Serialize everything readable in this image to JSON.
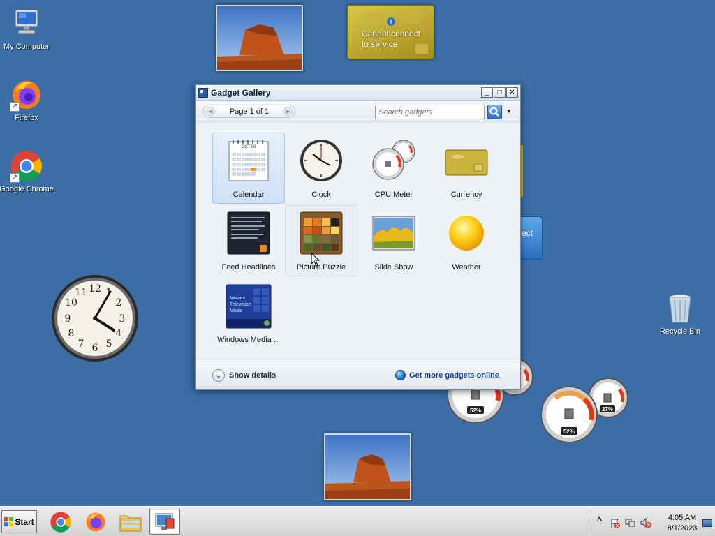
{
  "desktop": {
    "icons": [
      {
        "label": "My Computer",
        "icon": "my-computer-icon"
      },
      {
        "label": "Firefox",
        "icon": "firefox-icon"
      },
      {
        "label": "Google Chrome",
        "icon": "chrome-icon"
      },
      {
        "label": "Recycle Bin",
        "icon": "recycle-bin-icon"
      }
    ],
    "currency_gadget": {
      "message_line1": "Cannot connect",
      "message_line2": "to service",
      "info_glyph": "i"
    },
    "cpu_meter_1": {
      "cpu": "52%"
    },
    "cpu_meter_2": {
      "cpu": "52%",
      "memory": "27%"
    },
    "peek_blue_text": "ect",
    "clock_gadget": {
      "hour": 4,
      "minute": 5
    }
  },
  "gallery": {
    "title": "Gadget Gallery",
    "window_buttons": {
      "minimize": "_",
      "maximize": "□",
      "close": "✕"
    },
    "pager": {
      "label": "Page 1 of 1",
      "prev": "◀",
      "next": "▶"
    },
    "search": {
      "placeholder": "Search gadgets",
      "dropdown": "▼"
    },
    "gadgets": [
      {
        "label": "Calendar",
        "icon": "calendar-icon",
        "state": "selected"
      },
      {
        "label": "Clock",
        "icon": "clock-icon"
      },
      {
        "label": "CPU Meter",
        "icon": "cpu-meter-icon"
      },
      {
        "label": "Currency",
        "icon": "currency-icon"
      },
      {
        "label": "Feed Headlines",
        "icon": "feed-headlines-icon"
      },
      {
        "label": "Picture Puzzle",
        "icon": "picture-puzzle-icon",
        "state": "hovered"
      },
      {
        "label": "Slide Show",
        "icon": "slide-show-icon"
      },
      {
        "label": "Weather",
        "icon": "weather-icon"
      },
      {
        "label": "Windows Media ...",
        "icon": "windows-media-center-icon"
      }
    ],
    "calendar_month": "OCT 06",
    "wmc_items": [
      "Movies",
      "Television",
      "Music"
    ],
    "show_details": "Show details",
    "show_details_glyph": "⌄",
    "more_gadgets": "Get more gadgets online"
  },
  "taskbar": {
    "start_label": "Start",
    "items": [
      {
        "name": "chrome",
        "icon": "chrome-icon"
      },
      {
        "name": "firefox",
        "icon": "firefox-icon"
      },
      {
        "name": "explorer",
        "icon": "folder-icon"
      },
      {
        "name": "gadgets",
        "icon": "gadgets-icon",
        "active": true
      }
    ],
    "tray_chevron": "^",
    "time": "4:05 AM",
    "date": "8/1/2023"
  },
  "colors": {
    "desktop_bg": "#3a6ea5",
    "selection": "#cfe1f6",
    "link": "#0d3d8a"
  }
}
